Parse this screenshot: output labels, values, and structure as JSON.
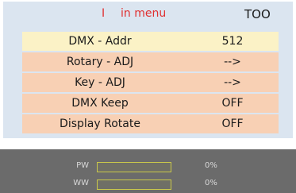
{
  "header": {
    "marker": "I",
    "title": "in menu",
    "right_label": "TOO"
  },
  "menu": {
    "items": [
      {
        "label": "DMX - Addr",
        "value": "512",
        "selected": true
      },
      {
        "label": "Rotary - ADJ",
        "value": "-->",
        "selected": false
      },
      {
        "label": "Key - ADJ",
        "value": "-->",
        "selected": false
      },
      {
        "label": "DMX Keep",
        "value": "OFF",
        "selected": false
      },
      {
        "label": "Display Rotate",
        "value": "OFF",
        "selected": false
      }
    ]
  },
  "status": {
    "bars": [
      {
        "label": "PW",
        "percent_text": "0%",
        "level": 0
      },
      {
        "label": "WW",
        "percent_text": "0%",
        "level": 0
      }
    ]
  },
  "colors": {
    "accent_text": "#e03030",
    "panel_background": "#dbe5f0",
    "row_background": "#f8d0b4",
    "selected_row_background": "#fbf2c6",
    "status_background": "#6b6b6b",
    "bar_color": "#c9c74b"
  }
}
